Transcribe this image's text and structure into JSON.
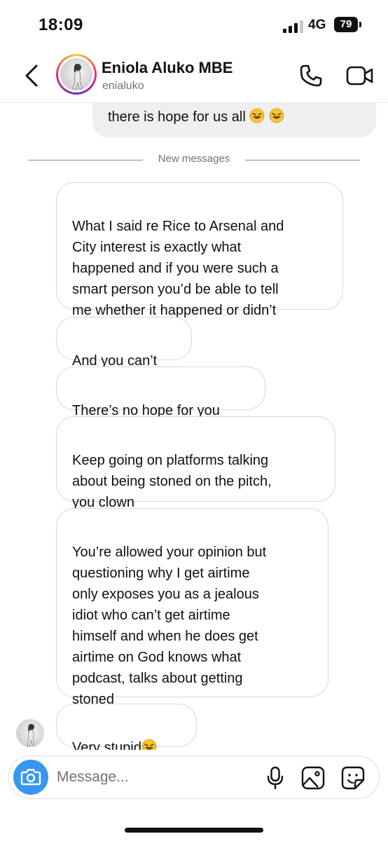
{
  "status_bar": {
    "time": "18:09",
    "network": "4G",
    "battery": "79"
  },
  "header": {
    "name": "Eniola Aluko MBE",
    "username": "enialuko"
  },
  "colors": {
    "accent": "#3897f0",
    "bubble_border": "#d8d8d8",
    "sent_bubble": "#efefef",
    "muted": "#737373"
  },
  "thread": {
    "sent_last": "there is hope for us all",
    "divider_label": "New messages",
    "messages": [
      "What I said re Rice to Arsenal and\nCity interest is exactly what\nhappened and if you were such a\nsmart person you’d be able to tell\nme whether it happened or didn’t",
      "And you can’t",
      "There’s no hope for you",
      "Keep going on platforms talking\nabout being stoned on the pitch,\nyou clown",
      "You’re allowed your opinion but\nquestioning why I get airtime\nonly exposes you as a jealous\nidiot who can’t get airtime\nhimself and when he does get\nairtime on God knows what\npodcast, talks about getting\nstoned",
      "Very stupid"
    ]
  },
  "composer": {
    "placeholder": "Message..."
  },
  "icons": {
    "back": "chevron-left-icon",
    "call": "phone-icon",
    "video": "video-camera-icon",
    "camera": "camera-icon",
    "mic": "microphone-icon",
    "gallery": "image-icon",
    "sticker": "sticker-icon",
    "emoji": "rolling-on-floor-laughing-emoji"
  }
}
